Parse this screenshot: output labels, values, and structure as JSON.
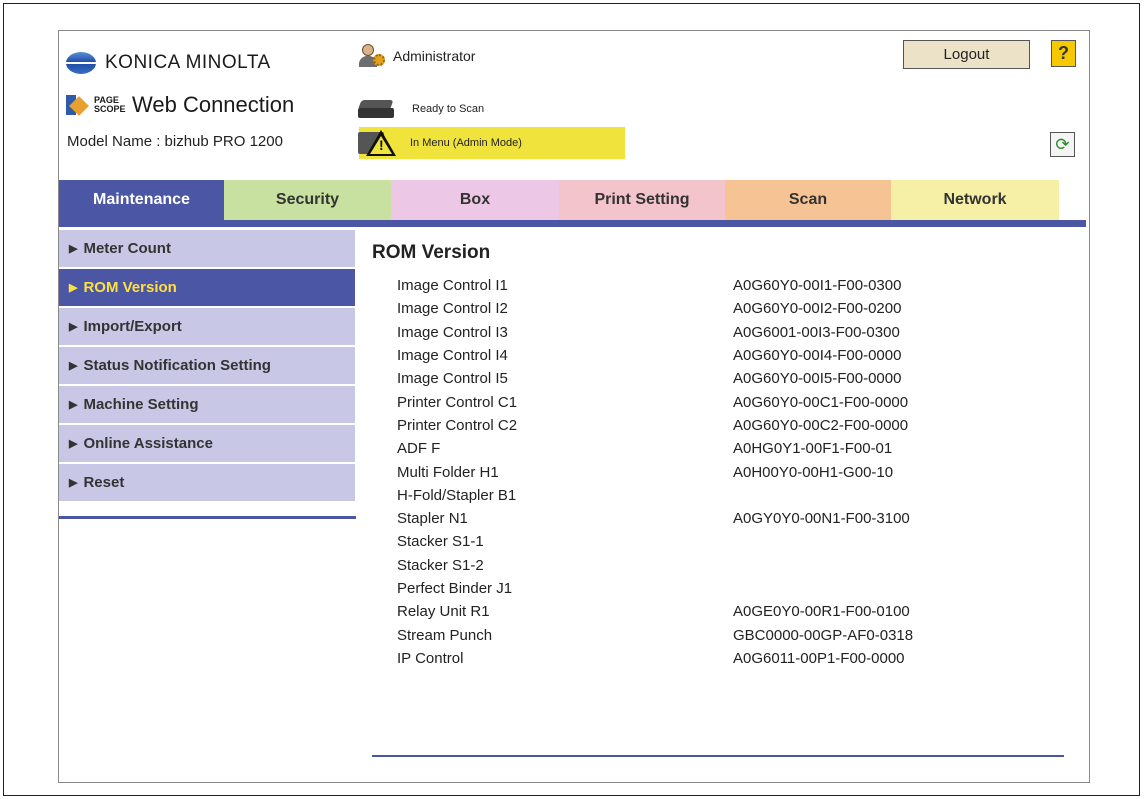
{
  "header": {
    "brand": "KONICA MINOLTA",
    "product_small": "PAGE SCOPE",
    "product_name": "Web Connection",
    "model_name": "Model Name : bizhub PRO 1200",
    "user": "Administrator",
    "logout_label": "Logout",
    "help_label": "?",
    "status_ready": "Ready to Scan",
    "status_warning": "In Menu (Admin Mode)",
    "warning_color": "#f0e43c"
  },
  "tabs": [
    {
      "label": "Maintenance",
      "color": "#4b56a4",
      "active": true
    },
    {
      "label": "Security",
      "color": "#c8e0a0"
    },
    {
      "label": "Box",
      "color": "#ecc8e6"
    },
    {
      "label": "Print Setting",
      "color": "#f4c4cc"
    },
    {
      "label": "Scan",
      "color": "#f6c494"
    },
    {
      "label": "Network",
      "color": "#f6f0a6"
    }
  ],
  "sidebar": {
    "items": [
      {
        "label": "Meter Count"
      },
      {
        "label": "ROM Version",
        "active": true
      },
      {
        "label": "Import/Export"
      },
      {
        "label": "Status Notification Setting"
      },
      {
        "label": "Machine Setting"
      },
      {
        "label": "Online Assistance"
      },
      {
        "label": "Reset"
      }
    ]
  },
  "content": {
    "title": "ROM Version",
    "rows": [
      {
        "name": "Image Control I1",
        "value": "A0G60Y0-00I1-F00-0300"
      },
      {
        "name": "Image Control I2",
        "value": "A0G60Y0-00I2-F00-0200"
      },
      {
        "name": "Image Control I3",
        "value": "A0G6001-00I3-F00-0300"
      },
      {
        "name": "Image Control I4",
        "value": "A0G60Y0-00I4-F00-0000"
      },
      {
        "name": "Image Control I5",
        "value": "A0G60Y0-00I5-F00-0000"
      },
      {
        "name": "Printer Control C1",
        "value": "A0G60Y0-00C1-F00-0000"
      },
      {
        "name": "Printer Control C2",
        "value": "A0G60Y0-00C2-F00-0000"
      },
      {
        "name": "ADF F",
        "value": "A0HG0Y1-00F1-F00-01"
      },
      {
        "name": "Multi Folder H1",
        "value": "A0H00Y0-00H1-G00-10"
      },
      {
        "name": "H-Fold/Stapler B1",
        "value": ""
      },
      {
        "name": "Stapler N1",
        "value": "A0GY0Y0-00N1-F00-3100"
      },
      {
        "name": "Stacker S1-1",
        "value": ""
      },
      {
        "name": "Stacker S1-2",
        "value": ""
      },
      {
        "name": "Perfect Binder J1",
        "value": ""
      },
      {
        "name": "Relay Unit R1",
        "value": "A0GE0Y0-00R1-F00-0100"
      },
      {
        "name": "Stream Punch",
        "value": "GBC0000-00GP-AF0-0318"
      },
      {
        "name": "IP Control",
        "value": "A0G6011-00P1-F00-0000"
      }
    ]
  }
}
